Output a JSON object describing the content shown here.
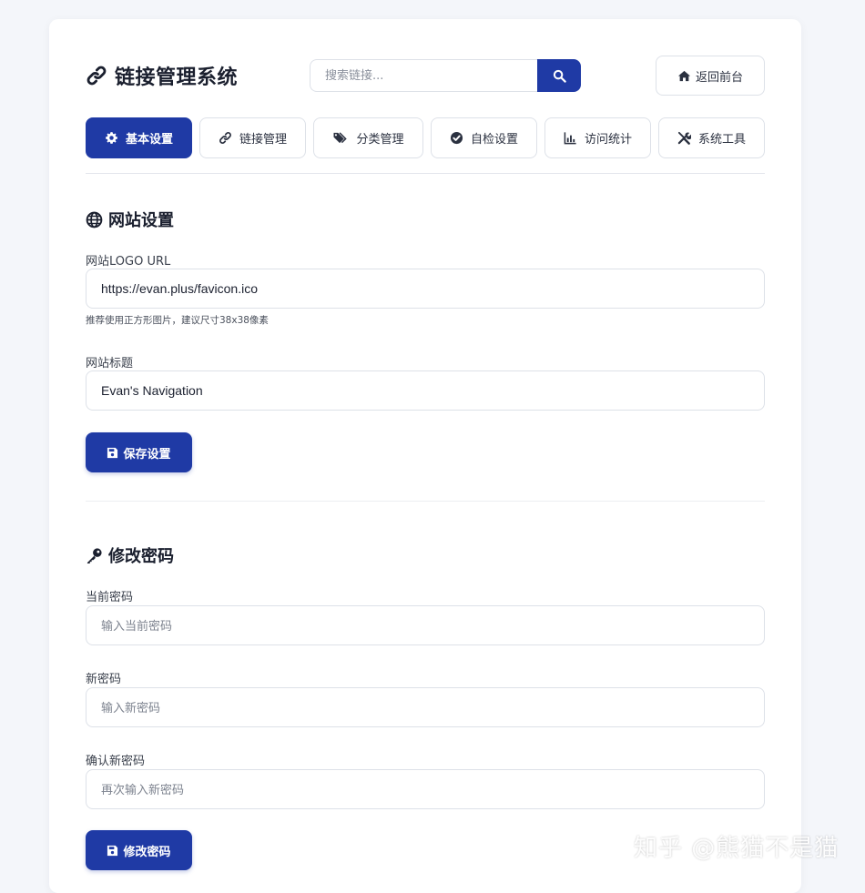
{
  "header": {
    "title": "链接管理系统",
    "search_placeholder": "搜索链接...",
    "back_label": "返回前台"
  },
  "tabs": [
    {
      "label": "基本设置",
      "icon": "gear-icon",
      "active": true
    },
    {
      "label": "链接管理",
      "icon": "link-icon",
      "active": false
    },
    {
      "label": "分类管理",
      "icon": "tags-icon",
      "active": false
    },
    {
      "label": "自检设置",
      "icon": "check-circle-icon",
      "active": false
    },
    {
      "label": "访问统计",
      "icon": "chart-icon",
      "active": false
    },
    {
      "label": "系统工具",
      "icon": "tools-icon",
      "active": false
    }
  ],
  "site_settings": {
    "title": "网站设置",
    "logo_label": "网站LOGO URL",
    "logo_value": "https://evan.plus/favicon.ico",
    "logo_hint": "推荐使用正方形图片，建议尺寸38x38像素",
    "site_title_label": "网站标题",
    "site_title_value": "Evan's Navigation",
    "save_label": "保存设置"
  },
  "password": {
    "title": "修改密码",
    "current_label": "当前密码",
    "current_placeholder": "输入当前密码",
    "new_label": "新密码",
    "new_placeholder": "输入新密码",
    "confirm_label": "确认新密码",
    "confirm_placeholder": "再次输入新密码",
    "submit_label": "修改密码"
  },
  "watermark": "知乎 @熊猫不是猫",
  "colors": {
    "primary": "#1f3aa5",
    "border": "#dde1e8",
    "text": "#1a1f2e"
  }
}
